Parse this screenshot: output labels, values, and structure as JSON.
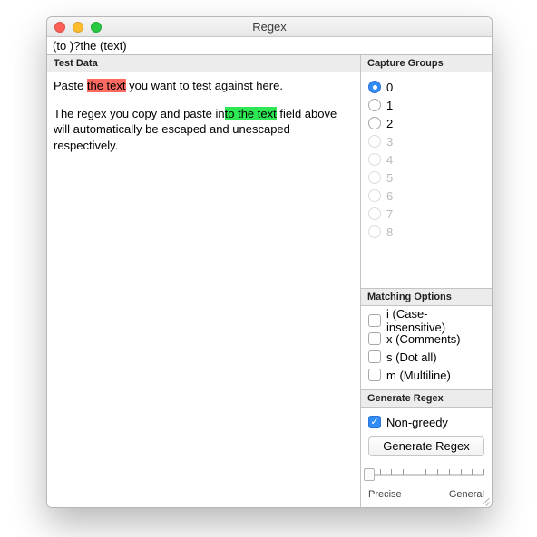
{
  "window": {
    "title": "Regex"
  },
  "regex": {
    "value": "(to )?the (text)"
  },
  "left": {
    "header": "Test Data",
    "test_data": {
      "line1_a": "Paste ",
      "line1_hl": "the text",
      "line1_b": " you want to test against here.",
      "line2_a": "The regex you copy and paste in",
      "line2_hl": "to the text",
      "line2_b": " field above will automatically be escaped and unescaped respectively."
    }
  },
  "right": {
    "capture_header": "Capture Groups",
    "groups": [
      "0",
      "1",
      "2",
      "3",
      "4",
      "5",
      "6",
      "7",
      "8"
    ],
    "selected_group": 0,
    "enabled_count": 3,
    "options_header": "Matching Options",
    "options": [
      {
        "label": "i (Case-insensitive)"
      },
      {
        "label": "x (Comments)"
      },
      {
        "label": "s (Dot all)"
      },
      {
        "label": "m (Multiline)"
      }
    ],
    "generate_header": "Generate Regex",
    "nongreedy_label": "Non-greedy",
    "generate_button": "Generate Regex",
    "slider_left": "Precise",
    "slider_right": "General"
  }
}
